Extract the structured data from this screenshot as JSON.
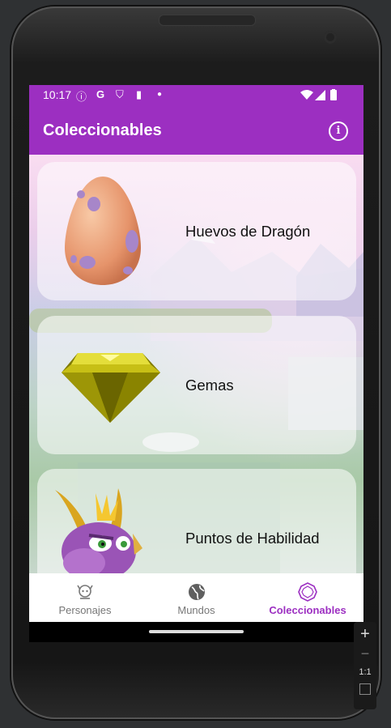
{
  "status_bar": {
    "time": "10:17"
  },
  "app_bar": {
    "title": "Coleccionables"
  },
  "cards": [
    {
      "label": "Huevos de Dragón",
      "icon": "dragon-egg-image"
    },
    {
      "label": "Gemas",
      "icon": "gem-image"
    },
    {
      "label": "Puntos de Habilidad",
      "icon": "spyro-image"
    }
  ],
  "bottom_nav": {
    "items": [
      {
        "label": "Personajes",
        "icon": "character-icon",
        "active": false
      },
      {
        "label": "Mundos",
        "icon": "globe-icon",
        "active": false
      },
      {
        "label": "Coleccionables",
        "icon": "gem-outline-icon",
        "active": true
      }
    ]
  },
  "zoom_controls": {
    "plus": "+",
    "minus": "−",
    "ratio": "1:1"
  },
  "colors": {
    "primary": "#9c2fc1",
    "nav_inactive": "#777777",
    "nav_active": "#9c2fc1"
  }
}
